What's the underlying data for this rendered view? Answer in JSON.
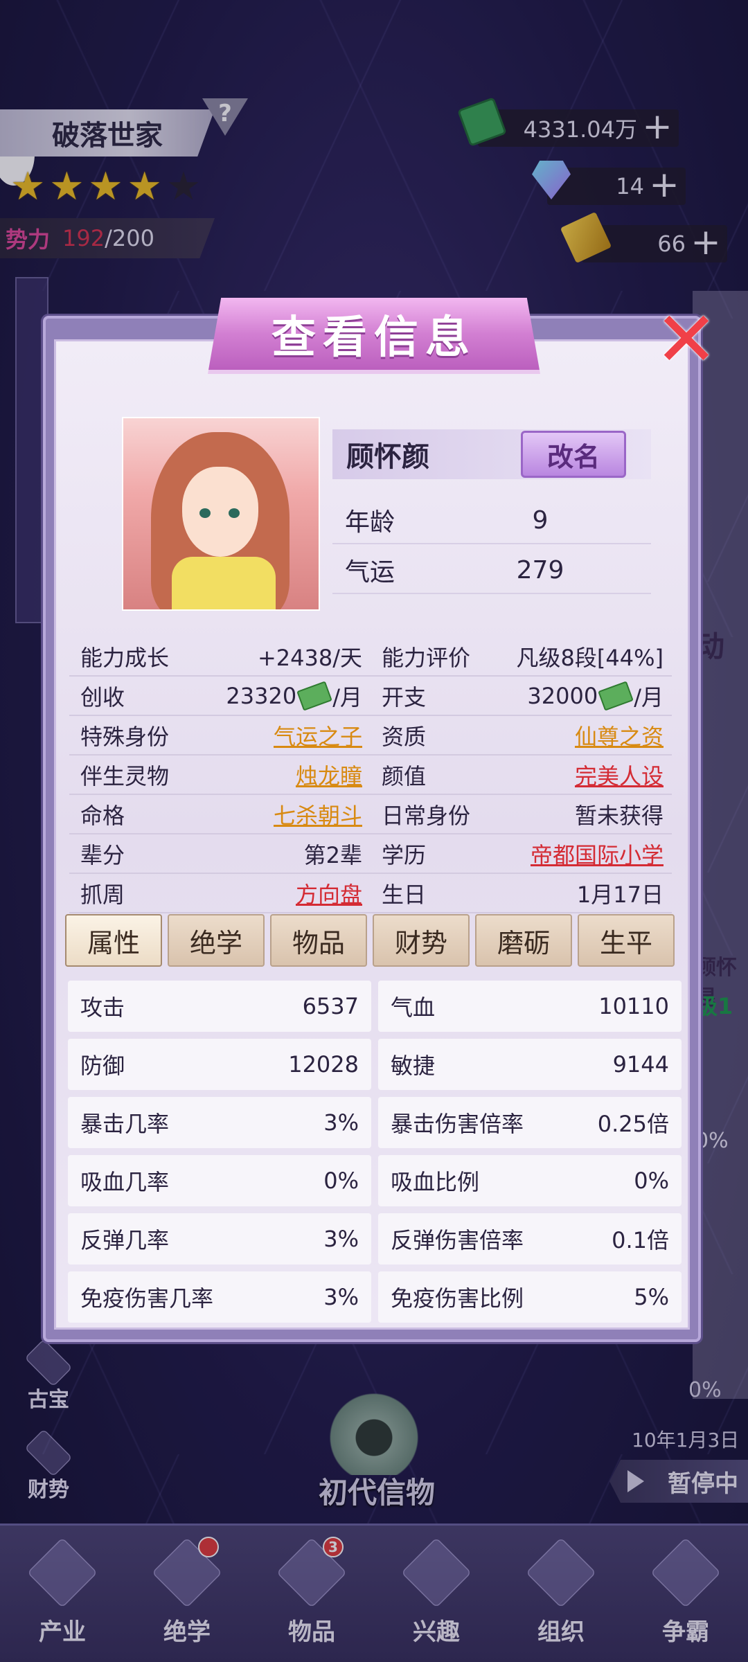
{
  "hud": {
    "family_title": "破落世家",
    "help_mark": "?",
    "star_rating": 4,
    "star_max": 5,
    "power_label": "势力",
    "power_current": "192",
    "power_max": "/200"
  },
  "resources": {
    "money": "4331.04万",
    "gems": "14",
    "gold": "66",
    "plus": "+"
  },
  "side_menu": [
    {
      "label": "古宝",
      "icon": "ancient-treasure-icon"
    },
    {
      "label": "财势",
      "icon": "wealth-icon"
    }
  ],
  "background_peek": {
    "right_label_top": "动",
    "right_name": "顾怀昆",
    "right_level": "级1",
    "right_percent": "0%",
    "progress_percent": "0%",
    "date": "10年1月3日",
    "pause_label": "暂停中",
    "relic_label": "初代信物"
  },
  "bottom_nav": [
    {
      "label": "产业",
      "icon": "industry-icon",
      "badge": ""
    },
    {
      "label": "绝学",
      "icon": "skill-icon",
      "badge": "dot"
    },
    {
      "label": "物品",
      "icon": "bag-icon",
      "badge": "3"
    },
    {
      "label": "兴趣",
      "icon": "chess-knight-icon",
      "badge": ""
    },
    {
      "label": "组织",
      "icon": "lock-icon",
      "badge": ""
    },
    {
      "label": "争霸",
      "icon": "trophy-icon",
      "badge": ""
    }
  ],
  "modal": {
    "title": "查看信息",
    "close_icon": "close-icon",
    "name": "顾怀颜",
    "rename_label": "改名",
    "age_label": "年龄",
    "age_value": "9",
    "luck_label": "气运",
    "luck_value": "279",
    "info_rows": [
      [
        {
          "k": "能力成长",
          "v": "+2438/天",
          "style": ""
        },
        {
          "k": "能力评价",
          "v": "凡级8段[44%]",
          "style": ""
        }
      ],
      [
        {
          "k": "创收",
          "v": "23320",
          "suffix": "/月",
          "money": true,
          "style": ""
        },
        {
          "k": "开支",
          "v": "32000",
          "suffix": "/月",
          "money": true,
          "style": ""
        }
      ],
      [
        {
          "k": "特殊身份",
          "v": "气运之子",
          "style": "gold"
        },
        {
          "k": "资质",
          "v": "仙尊之资",
          "style": "gold"
        }
      ],
      [
        {
          "k": "伴生灵物",
          "v": "烛龙瞳",
          "style": "gold"
        },
        {
          "k": "颜值",
          "v": "完美人设",
          "style": "red"
        }
      ],
      [
        {
          "k": "命格",
          "v": "七杀朝斗",
          "style": "gold"
        },
        {
          "k": "日常身份",
          "v": "暂未获得",
          "style": ""
        }
      ],
      [
        {
          "k": "辈分",
          "v": "第2辈",
          "style": ""
        },
        {
          "k": "学历",
          "v": "帝都国际小学",
          "style": "red"
        }
      ],
      [
        {
          "k": "抓周",
          "v": "方向盘",
          "style": "red"
        },
        {
          "k": "生日",
          "v": "1月17日",
          "style": ""
        }
      ]
    ],
    "tabs": [
      "属性",
      "绝学",
      "物品",
      "财势",
      "磨砺",
      "生平"
    ],
    "active_tab": 0,
    "stats": [
      [
        {
          "k": "攻击",
          "v": "6537"
        },
        {
          "k": "气血",
          "v": "10110"
        }
      ],
      [
        {
          "k": "防御",
          "v": "12028"
        },
        {
          "k": "敏捷",
          "v": "9144"
        }
      ],
      [
        {
          "k": "暴击几率",
          "v": "3%"
        },
        {
          "k": "暴击伤害倍率",
          "v": "0.25倍"
        }
      ],
      [
        {
          "k": "吸血几率",
          "v": "0%"
        },
        {
          "k": "吸血比例",
          "v": "0%"
        }
      ],
      [
        {
          "k": "反弹几率",
          "v": "3%"
        },
        {
          "k": "反弹伤害倍率",
          "v": "0.1倍"
        }
      ],
      [
        {
          "k": "免疫伤害几率",
          "v": "3%"
        },
        {
          "k": "免疫伤害比例",
          "v": "5%"
        }
      ]
    ]
  }
}
